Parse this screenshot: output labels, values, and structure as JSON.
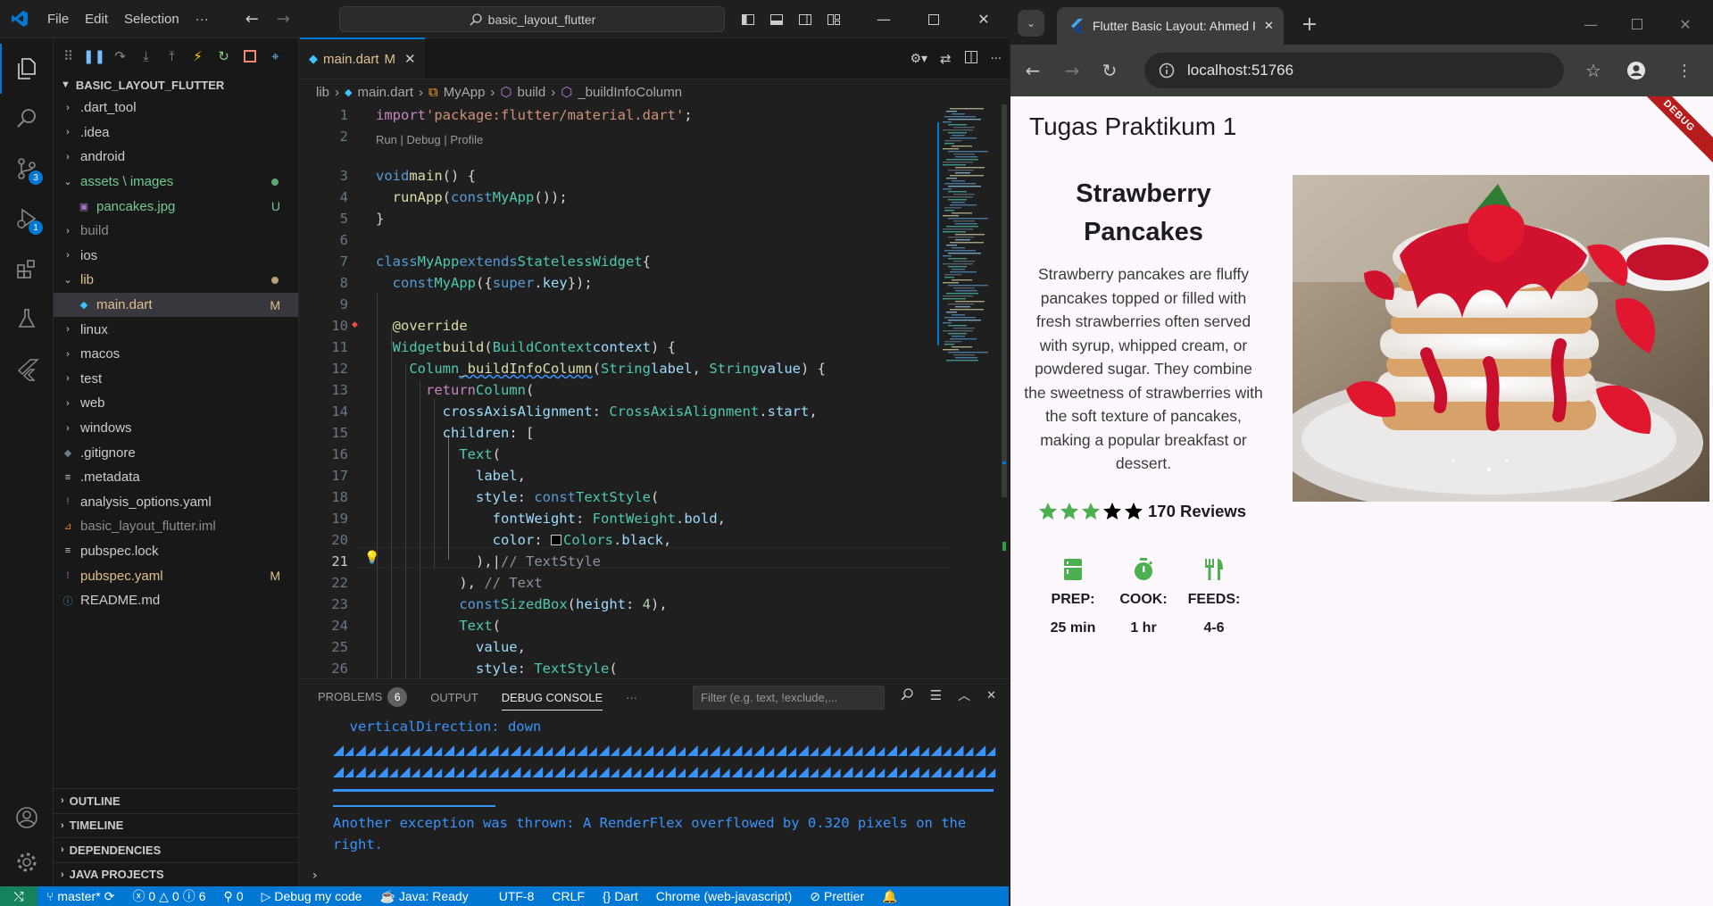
{
  "vscode": {
    "menu": [
      "File",
      "Edit",
      "Selection",
      "···"
    ],
    "command_center": "basic_layout_flutter",
    "explorer": {
      "root": "BASIC_LAYOUT_FLUTTER",
      "items": [
        {
          "label": ".dart_tool",
          "type": "folder",
          "state": "collapsed",
          "color": "#cccccc"
        },
        {
          "label": ".idea",
          "type": "folder",
          "state": "collapsed",
          "color": "#cccccc"
        },
        {
          "label": "android",
          "type": "folder",
          "state": "collapsed",
          "color": "#cccccc"
        },
        {
          "label": "assets \\ images",
          "type": "folder",
          "state": "expanded",
          "color": "#73c991"
        },
        {
          "label": "pancakes.jpg",
          "type": "file",
          "status": "U",
          "color": "#73c991"
        },
        {
          "label": "build",
          "type": "folder",
          "state": "collapsed",
          "color": "#8c8c8c"
        },
        {
          "label": "ios",
          "type": "folder",
          "state": "collapsed",
          "color": "#cccccc"
        },
        {
          "label": "lib",
          "type": "folder",
          "state": "expanded",
          "color": "#e2c08d"
        },
        {
          "label": "main.dart",
          "type": "file",
          "status": "M",
          "color": "#e2c08d"
        },
        {
          "label": "linux",
          "type": "folder",
          "state": "collapsed",
          "color": "#cccccc"
        },
        {
          "label": "macos",
          "type": "folder",
          "state": "collapsed",
          "color": "#cccccc"
        },
        {
          "label": "test",
          "type": "folder",
          "state": "collapsed",
          "color": "#cccccc"
        },
        {
          "label": "web",
          "type": "folder",
          "state": "collapsed",
          "color": "#cccccc"
        },
        {
          "label": "windows",
          "type": "folder",
          "state": "collapsed",
          "color": "#cccccc"
        },
        {
          "label": ".gitignore",
          "type": "file",
          "color": "#cccccc"
        },
        {
          "label": ".metadata",
          "type": "file",
          "color": "#cccccc"
        },
        {
          "label": "analysis_options.yaml",
          "type": "file",
          "color": "#cccccc"
        },
        {
          "label": "basic_layout_flutter.iml",
          "type": "file",
          "color": "#8c8c8c"
        },
        {
          "label": "pubspec.lock",
          "type": "file",
          "color": "#cccccc"
        },
        {
          "label": "pubspec.yaml",
          "type": "file",
          "status": "M",
          "color": "#e2c08d"
        },
        {
          "label": "README.md",
          "type": "file",
          "color": "#cccccc"
        }
      ],
      "sections": [
        "OUTLINE",
        "TIMELINE",
        "DEPENDENCIES",
        "JAVA PROJECTS"
      ]
    },
    "activity_badges": {
      "source_control": "3",
      "run_debug": "1"
    },
    "tab": {
      "label": "main.dart",
      "modified": "M"
    },
    "breadcrumb": [
      "lib",
      "main.dart",
      "MyApp",
      "build",
      "_buildInfoColumn"
    ],
    "codelens": "Run | Debug | Profile",
    "line_numbers": [
      "1",
      "2",
      "3",
      "4",
      "5",
      "6",
      "7",
      "8",
      "9",
      "10",
      "11",
      "12",
      "13",
      "14",
      "15",
      "16",
      "17",
      "18",
      "19",
      "20",
      "21",
      "22",
      "23",
      "24",
      "25",
      "26"
    ],
    "current_line": "21",
    "panel": {
      "tabs": [
        "PROBLEMS",
        "OUTPUT",
        "DEBUG CONSOLE",
        "···"
      ],
      "problems_count": "6",
      "active_tab": "DEBUG CONSOLE",
      "filter_placeholder": "Filter (e.g. text, !exclude,...",
      "console_lines": [
        "  verticalDirection: down",
        "Another exception was thrown: A RenderFlex overflowed by 0.320 pixels on the",
        "right."
      ]
    },
    "statusbar": {
      "branch": "master*",
      "errors": "0",
      "warnings": "0",
      "infos": "6",
      "ports": "0",
      "debug": "Debug my code",
      "java": "Java: Ready",
      "encoding": "UTF-8",
      "eol": "CRLF",
      "language": "Dart",
      "device": "Chrome (web-javascript)",
      "formatter": "Prettier"
    }
  },
  "chrome": {
    "tab_title": "Flutter Basic Layout: Ahmed Fat",
    "url": "localhost:51766",
    "app": {
      "appbar_title": "Tugas Praktikum 1",
      "debug_banner": "DEBUG",
      "recipe_title": "Strawberry Pancakes",
      "description": "Strawberry pancakes are fluffy pancakes topped or filled with fresh strawberries often served with syrup, whipped cream, or powdered sugar. They combine the sweetness of strawberries with the soft texture of pancakes, making a popular breakfast or dessert.",
      "rating": {
        "filled": 3,
        "total": 5,
        "filled_color": "#4caf50"
      },
      "reviews": "170 Reviews",
      "info": [
        {
          "label": "PREP:",
          "value": "25 min",
          "icon": "kitchen-icon"
        },
        {
          "label": "COOK:",
          "value": "1 hr",
          "icon": "timer-icon"
        },
        {
          "label": "FEEDS:",
          "value": "4-6",
          "icon": "restaurant-icon"
        }
      ],
      "icon_color": "#4caf50"
    }
  }
}
